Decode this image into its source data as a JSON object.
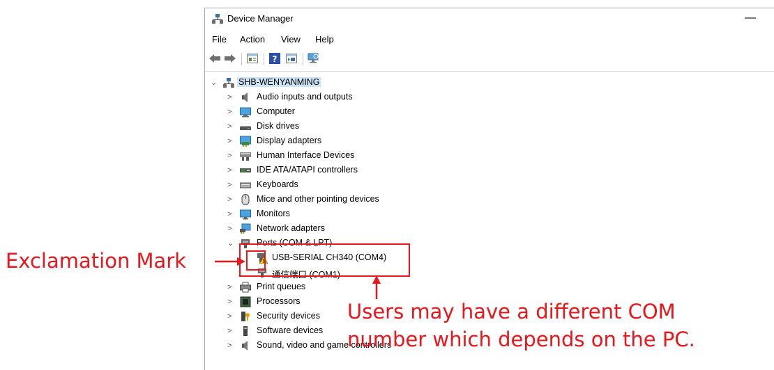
{
  "window": {
    "title": "Device Manager",
    "minimize_glyph": "—"
  },
  "menu": {
    "items": [
      "File",
      "Action",
      "View",
      "Help"
    ]
  },
  "toolbar": {
    "buttons": [
      "back-arrow-icon",
      "forward-arrow-icon",
      "properties-icon",
      "help-icon",
      "update-driver-icon",
      "scan-hardware-icon"
    ]
  },
  "tree": {
    "root": {
      "label": "SHB-WENYANMING",
      "chevron": "⌄"
    },
    "collapsed_chevron": ">",
    "expanded_chevron": "⌄",
    "categories": [
      {
        "label": "Audio inputs and outputs",
        "icon": "speaker-icon"
      },
      {
        "label": "Computer",
        "icon": "computer-icon"
      },
      {
        "label": "Disk drives",
        "icon": "disk-drive-icon"
      },
      {
        "label": "Display adapters",
        "icon": "display-adapter-icon"
      },
      {
        "label": "Human Interface Devices",
        "icon": "hid-icon"
      },
      {
        "label": "IDE ATA/ATAPI controllers",
        "icon": "ide-controller-icon"
      },
      {
        "label": "Keyboards",
        "icon": "keyboard-icon"
      },
      {
        "label": "Mice and other pointing devices",
        "icon": "mouse-icon"
      },
      {
        "label": "Monitors",
        "icon": "monitor-icon"
      },
      {
        "label": "Network adapters",
        "icon": "network-adapter-icon"
      },
      {
        "label": "Ports (COM & LPT)",
        "icon": "port-icon",
        "expanded": true
      },
      {
        "label": "Print queues",
        "icon": "printer-icon"
      },
      {
        "label": "Processors",
        "icon": "processor-icon"
      },
      {
        "label": "Security devices",
        "icon": "security-device-icon"
      },
      {
        "label": "Software devices",
        "icon": "software-device-icon"
      },
      {
        "label": "Sound, video and game controllers",
        "icon": "sound-controller-icon"
      }
    ],
    "ports_children": [
      {
        "label": "USB-SERIAL CH340 (COM4)",
        "icon": "warning-port-icon"
      },
      {
        "label": "通信端口 (COM1)",
        "icon": "port-icon"
      }
    ]
  },
  "annotations": {
    "exclamation_label": "Exclamation Mark",
    "note_line1": "Users may have a different COM",
    "note_line2": "number which depends on the PC.",
    "color": "#e8171b"
  }
}
